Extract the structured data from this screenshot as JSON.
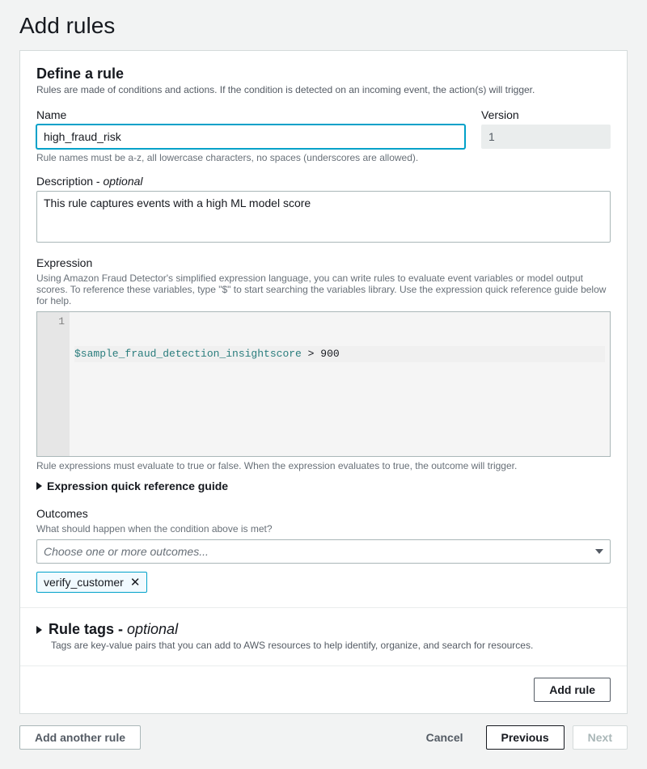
{
  "page": {
    "title": "Add rules"
  },
  "rule": {
    "heading": "Define a rule",
    "sub": "Rules are made of conditions and actions. If the condition is detected on an incoming event, the action(s) will trigger.",
    "name_label": "Name",
    "name_value": "high_fraud_risk",
    "name_hint": "Rule names must be a-z, all lowercase characters, no spaces (underscores are allowed).",
    "version_label": "Version",
    "version_value": "1",
    "description_label_main": "Description - ",
    "description_label_optional": "optional",
    "description_value": "This rule captures events with a high ML model score",
    "expression_label": "Expression",
    "expression_help": "Using Amazon Fraud Detector's simplified expression language, you can write rules to evaluate event variables or model output scores. To reference these variables, type \"$\" to start searching the variables library. Use the expression quick reference guide below for help.",
    "expression_line_no": "1",
    "expression_var": "$sample_fraud_detection_insightscore",
    "expression_op": ">",
    "expression_num": "900",
    "expression_hint": "Rule expressions must evaluate to true or false. When the expression evaluates to true, the outcome will trigger.",
    "expression_guide": "Expression quick reference guide",
    "outcomes_label": "Outcomes",
    "outcomes_sub": "What should happen when the condition above is met?",
    "outcomes_placeholder": "Choose one or more outcomes...",
    "outcome_chip": "verify_customer",
    "ruletags_title_main": "Rule tags - ",
    "ruletags_title_optional": "optional",
    "ruletags_sub": "Tags are key-value pairs that you can add to AWS resources to help identify, organize, and search for resources.",
    "add_rule_btn": "Add rule"
  },
  "footer": {
    "add_another": "Add another rule",
    "cancel": "Cancel",
    "previous": "Previous",
    "next": "Next"
  }
}
